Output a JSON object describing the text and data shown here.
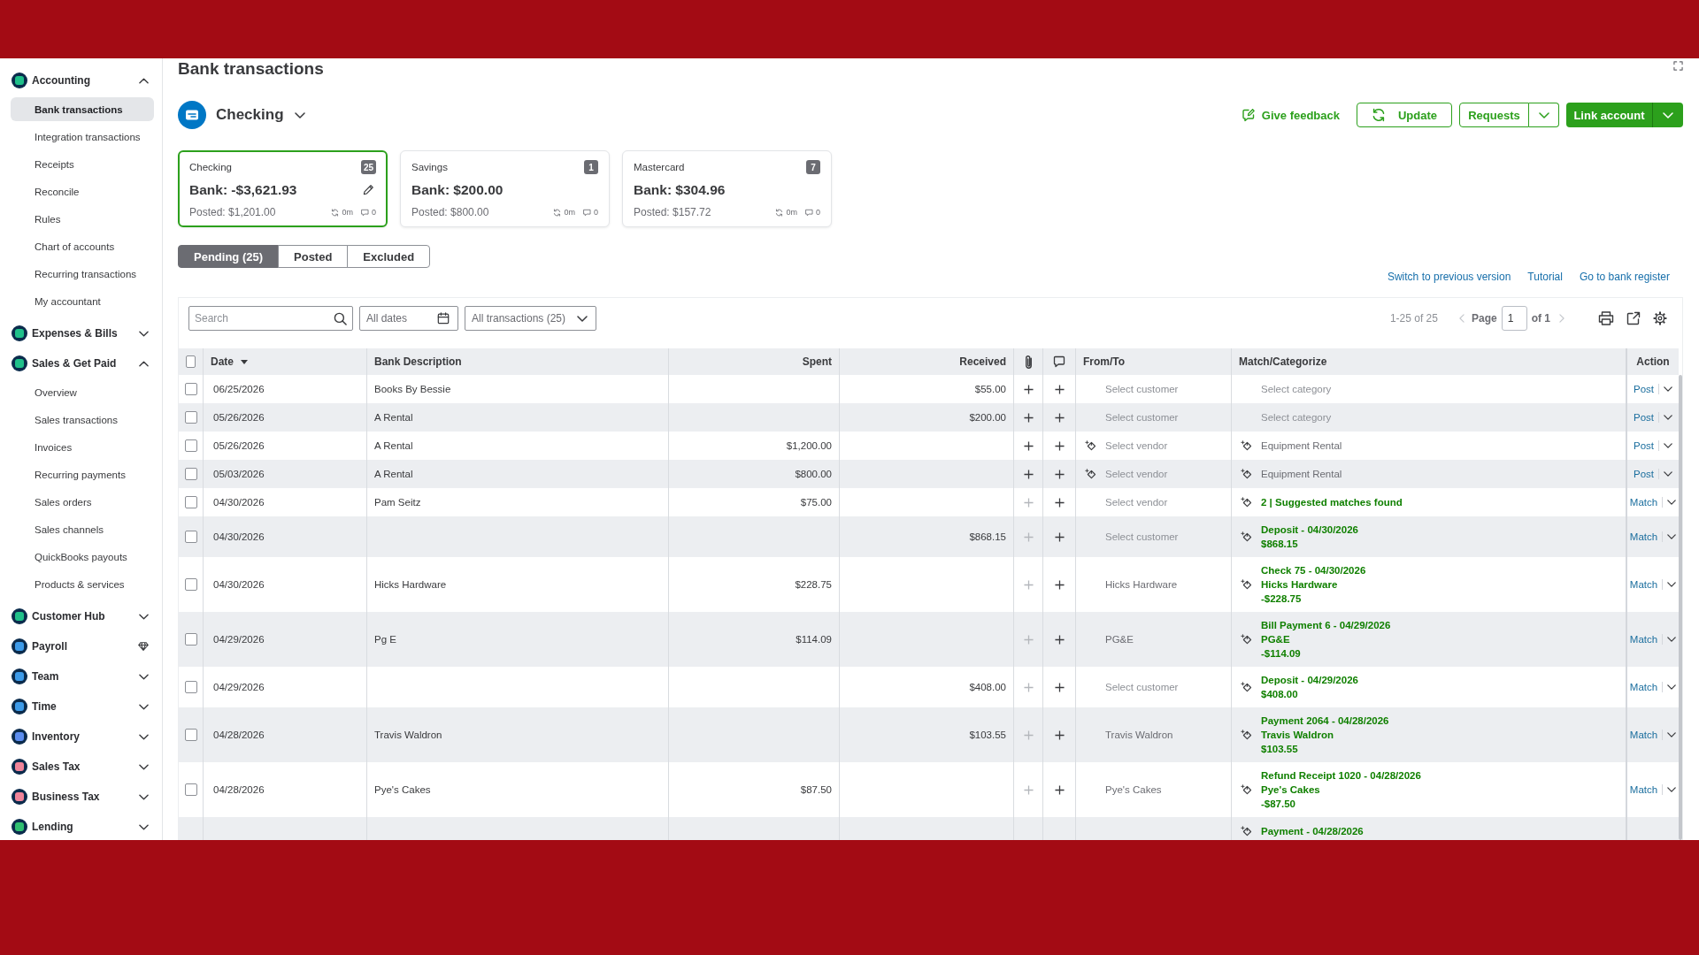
{
  "sidebar": {
    "items": [
      {
        "label": "Accounting",
        "kind": "group",
        "expanded": true,
        "color": "#1fc08a",
        "children": [
          {
            "label": "Bank transactions",
            "selected": true
          },
          {
            "label": "Integration transactions",
            "selected": false
          },
          {
            "label": "Receipts",
            "selected": false
          },
          {
            "label": "Reconcile",
            "selected": false
          },
          {
            "label": "Rules",
            "selected": false
          },
          {
            "label": "Chart of accounts",
            "selected": false
          },
          {
            "label": "Recurring transactions",
            "selected": false
          },
          {
            "label": "My accountant",
            "selected": false
          }
        ]
      },
      {
        "label": "Expenses & Bills",
        "kind": "group",
        "expanded": false,
        "color": "#1fc08a"
      },
      {
        "label": "Sales & Get Paid",
        "kind": "group",
        "expanded": true,
        "color": "#1fc08a",
        "children": [
          {
            "label": "Overview",
            "selected": false
          },
          {
            "label": "Sales transactions",
            "selected": false
          },
          {
            "label": "Invoices",
            "selected": false
          },
          {
            "label": "Recurring payments",
            "selected": false
          },
          {
            "label": "Sales orders",
            "selected": false
          },
          {
            "label": "Sales channels",
            "selected": false
          },
          {
            "label": "QuickBooks payouts",
            "selected": false
          },
          {
            "label": "Products & services",
            "selected": false
          }
        ]
      },
      {
        "label": "Customer Hub",
        "kind": "group",
        "expanded": false,
        "color": "#1fc08a"
      },
      {
        "label": "Payroll",
        "kind": "upsell",
        "color": "#3d9be9"
      },
      {
        "label": "Team",
        "kind": "group",
        "expanded": false,
        "color": "#3d9be9"
      },
      {
        "label": "Time",
        "kind": "group",
        "expanded": false,
        "color": "#3d9be9"
      },
      {
        "label": "Inventory",
        "kind": "group",
        "expanded": false,
        "color": "#5b8def"
      },
      {
        "label": "Sales Tax",
        "kind": "group",
        "expanded": false,
        "color": "#f0849a"
      },
      {
        "label": "Business Tax",
        "kind": "group",
        "expanded": false,
        "color": "#f0849a"
      },
      {
        "label": "Lending",
        "kind": "group",
        "expanded": false,
        "color": "#2fbf71"
      }
    ]
  },
  "page": {
    "title": "Bank transactions"
  },
  "account": {
    "name": "Checking"
  },
  "header_actions": [
    {
      "kind": "link",
      "label": "Give feedback"
    },
    {
      "kind": "outline",
      "label": "Update"
    },
    {
      "kind": "split",
      "label": "Requests"
    },
    {
      "kind": "split_primary",
      "label": "Link account"
    }
  ],
  "account_cards": [
    {
      "name": "Checking",
      "count": "25",
      "bank": "Bank: -$3,621.93",
      "posted": "Posted: $1,201.00",
      "sync": "0m",
      "comments": "0",
      "selected": true
    },
    {
      "name": "Savings",
      "count": "1",
      "bank": "Bank: $200.00",
      "posted": "Posted: $800.00",
      "sync": "0m",
      "comments": "0",
      "selected": false
    },
    {
      "name": "Mastercard",
      "count": "7",
      "bank": "Bank: $304.96",
      "posted": "Posted: $157.72",
      "sync": "0m",
      "comments": "0",
      "selected": false
    }
  ],
  "tabs": [
    {
      "label": "Pending (25)",
      "selected": true
    },
    {
      "label": "Posted",
      "selected": false
    },
    {
      "label": "Excluded",
      "selected": false
    }
  ],
  "links": [
    "Switch to previous version",
    "Tutorial",
    "Go to bank register"
  ],
  "toolbar": {
    "search": {
      "placeholder": "Search"
    },
    "filters": [
      {
        "kind": "date",
        "value": "All dates"
      },
      {
        "kind": "type",
        "value": "All transactions (25)"
      }
    ],
    "pagination": {
      "range": "1-25 of 25",
      "page_label": "Page",
      "page": "1",
      "page_total": "of 1",
      "prev_disabled": true,
      "next_disabled": true
    }
  },
  "table": {
    "select_all": {
      "checked": false
    },
    "columns": [
      {
        "kind": "text",
        "label": "Date",
        "sorted": true
      },
      {
        "kind": "text",
        "label": "Bank Description"
      },
      {
        "kind": "text",
        "label": "Spent"
      },
      {
        "kind": "text",
        "label": "Received"
      },
      {
        "kind": "attachments"
      },
      {
        "kind": "notes"
      },
      {
        "kind": "text",
        "label": "From/To"
      },
      {
        "kind": "text",
        "label": "Match/Categorize"
      },
      {
        "kind": "text",
        "label": "Action"
      }
    ],
    "rows": [
      {
        "checked": false,
        "date": "06/25/2026",
        "description": "Books By Bessie",
        "received": "$55.00",
        "attach": {
          "disabled": false
        },
        "from_to": {
          "placeholder": "Select customer",
          "suggested": false
        },
        "match": {
          "kind": "category",
          "placeholder": "Select category",
          "suggested": false
        },
        "action": "Post"
      },
      {
        "checked": false,
        "date": "05/26/2026",
        "description": "A Rental",
        "received": "$200.00",
        "attach": {
          "disabled": false
        },
        "from_to": {
          "placeholder": "Select customer",
          "suggested": false
        },
        "match": {
          "kind": "category",
          "placeholder": "Select category",
          "suggested": false
        },
        "action": "Post"
      },
      {
        "checked": false,
        "date": "05/26/2026",
        "description": "A Rental",
        "spent": "$1,200.00",
        "attach": {
          "disabled": false
        },
        "from_to": {
          "placeholder": "Select vendor",
          "suggested": true
        },
        "match": {
          "kind": "category",
          "value": "Equipment Rental",
          "suggested": true
        },
        "action": "Post"
      },
      {
        "checked": false,
        "date": "05/03/2026",
        "description": "A Rental",
        "spent": "$800.00",
        "attach": {
          "disabled": false
        },
        "from_to": {
          "placeholder": "Select vendor",
          "suggested": true
        },
        "match": {
          "kind": "category",
          "value": "Equipment Rental",
          "suggested": true
        },
        "action": "Post"
      },
      {
        "checked": false,
        "date": "04/30/2026",
        "description": "Pam Seitz",
        "spent": "$75.00",
        "attach": {
          "disabled": true
        },
        "from_to": {
          "placeholder": "Select vendor",
          "suggested": false
        },
        "match": {
          "kind": "suggestion",
          "lines": [
            "2 | Suggested matches found"
          ]
        },
        "action": "Match"
      },
      {
        "checked": false,
        "date": "04/30/2026",
        "received": "$868.15",
        "attach": {
          "disabled": true
        },
        "from_to": {
          "placeholder": "Select customer",
          "suggested": false
        },
        "match": {
          "kind": "suggestion",
          "lines": [
            "Deposit - 04/30/2026",
            "$868.15"
          ]
        },
        "action": "Match"
      },
      {
        "checked": false,
        "date": "04/30/2026",
        "description": "Hicks Hardware",
        "spent": "$228.75",
        "attach": {
          "disabled": true
        },
        "from_to": {
          "value": "Hicks Hardware",
          "suggested": false
        },
        "match": {
          "kind": "suggestion",
          "lines": [
            "Check 75 - 04/30/2026",
            "Hicks Hardware",
            "-$228.75"
          ]
        },
        "action": "Match"
      },
      {
        "checked": false,
        "date": "04/29/2026",
        "description": "Pg E",
        "spent": "$114.09",
        "attach": {
          "disabled": true
        },
        "from_to": {
          "value": "PG&E",
          "suggested": false
        },
        "match": {
          "kind": "suggestion",
          "lines": [
            "Bill Payment 6 - 04/29/2026",
            "PG&E",
            "-$114.09"
          ]
        },
        "action": "Match"
      },
      {
        "checked": false,
        "date": "04/29/2026",
        "received": "$408.00",
        "attach": {
          "disabled": true
        },
        "from_to": {
          "placeholder": "Select customer",
          "suggested": false
        },
        "match": {
          "kind": "suggestion",
          "lines": [
            "Deposit - 04/29/2026",
            "$408.00"
          ]
        },
        "action": "Match"
      },
      {
        "checked": false,
        "date": "04/28/2026",
        "description": "Travis Waldron",
        "received": "$103.55",
        "attach": {
          "disabled": true
        },
        "from_to": {
          "value": "Travis Waldron",
          "suggested": false
        },
        "match": {
          "kind": "suggestion",
          "lines": [
            "Payment 2064 - 04/28/2026",
            "Travis Waldron",
            "$103.55"
          ]
        },
        "action": "Match"
      },
      {
        "checked": false,
        "date": "04/28/2026",
        "description": "Pye's Cakes",
        "spent": "$87.50",
        "attach": {
          "disabled": true
        },
        "from_to": {
          "value": "Pye's Cakes",
          "suggested": false
        },
        "match": {
          "kind": "suggestion",
          "lines": [
            "Refund Receipt 1020 - 04/28/2026",
            "Pye's Cakes",
            "-$87.50"
          ]
        },
        "action": "Match"
      },
      {
        "match": {
          "kind": "suggestion",
          "lines": [
            "Payment - 04/28/2026"
          ]
        }
      }
    ]
  }
}
